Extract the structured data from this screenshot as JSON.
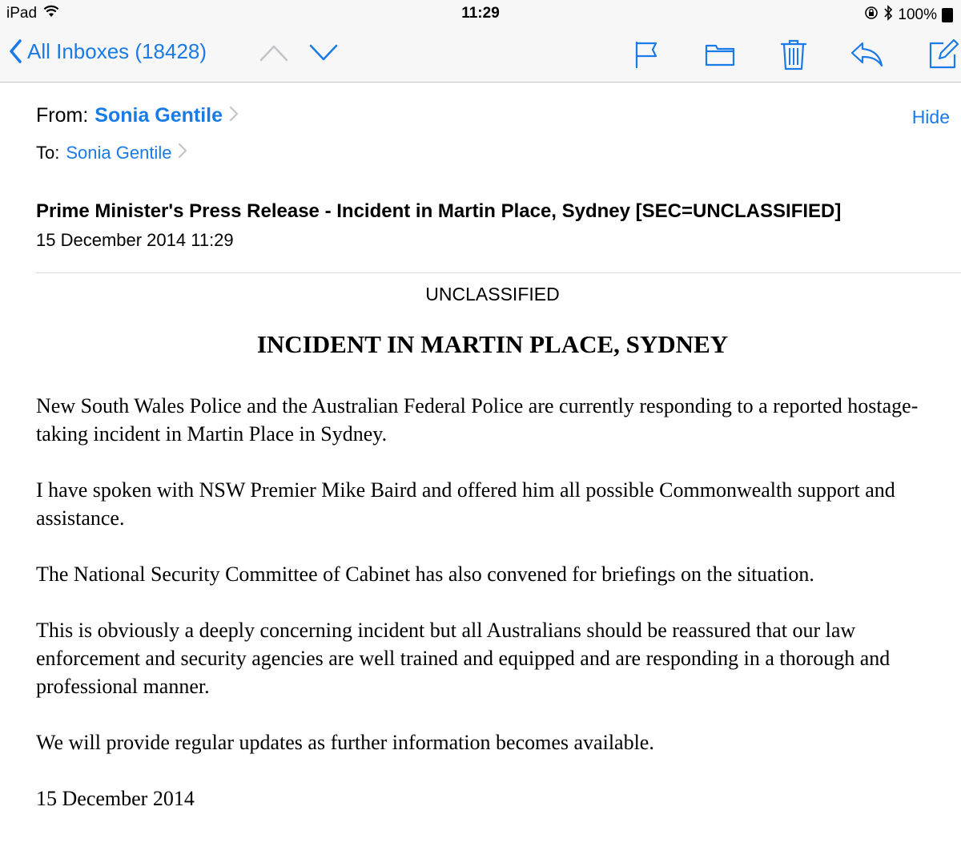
{
  "status_bar": {
    "device": "iPad",
    "time": "11:29",
    "battery": "100%"
  },
  "toolbar": {
    "back_label": "All Inboxes (18428)"
  },
  "header": {
    "from_label": "From:",
    "from_name": "Sonia Gentile",
    "to_label": "To:",
    "to_name": "Sonia Gentile",
    "hide_label": "Hide",
    "subject": "Prime Minister's Press Release - Incident in Martin Place, Sydney [SEC=UNCLASSIFIED]",
    "date": "15 December 2014 11:29"
  },
  "body": {
    "classification": "UNCLASSIFIED",
    "headline": "INCIDENT IN MARTIN PLACE, SYDNEY",
    "paragraphs": [
      "New South Wales Police and the Australian Federal Police are currently responding to a reported hostage-taking incident in Martin Place in Sydney.",
      "I have spoken with NSW Premier Mike Baird and offered him all possible Commonwealth support and assistance.",
      "The National Security Committee of Cabinet has also convened for briefings on the situation.",
      "This is obviously a deeply concerning incident but all Australians should be reassured that our law enforcement and security agencies are well trained and equipped and are responding in a thorough and professional manner.",
      "We will provide regular updates as further information becomes available.",
      "15 December 2014"
    ]
  },
  "colors": {
    "accent": "#1a7ae6",
    "toolbar_bg": "#f7f7f8"
  }
}
